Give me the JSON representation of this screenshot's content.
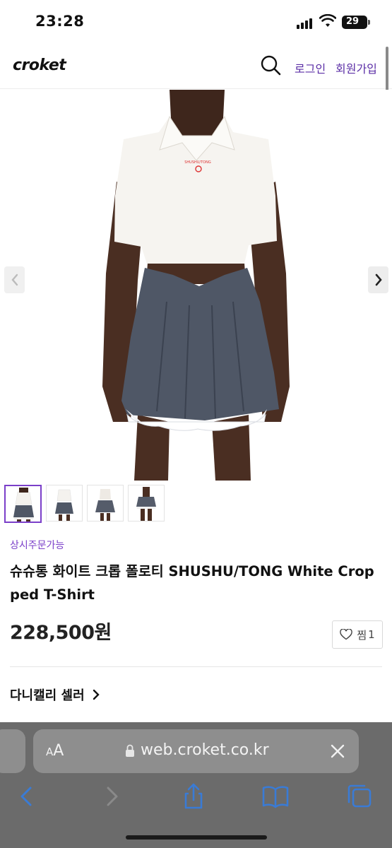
{
  "status_bar": {
    "time": "23:28",
    "battery": "29"
  },
  "header": {
    "logo": "croket",
    "login": "로그인",
    "signup": "회원가입"
  },
  "product": {
    "order_tag": "상시주문가능",
    "title": "슈슈통 화이트 크롭 폴로티 SHUSHU/TONG White Cropped T-Shirt",
    "price": "228,500원",
    "wish_label": "찜",
    "wish_count": "1",
    "seller": "다니캘리 셀러",
    "thumbnail_count": 4
  },
  "browser": {
    "aa": "AA",
    "url": "web.croket.co.kr"
  },
  "icons": {
    "search": "search-icon",
    "prev": "chevron-left-icon",
    "next": "chevron-right-icon",
    "heart": "heart-icon",
    "lock": "lock-icon",
    "close": "close-icon",
    "back": "back-icon",
    "forward": "forward-icon",
    "share": "share-icon",
    "bookmarks": "bookmarks-icon",
    "tabs": "tabs-icon"
  },
  "colors": {
    "accent": "#7b3fc9",
    "link": "#5b2ea6",
    "browser_bar": "#6b6b6b",
    "browser_blue": "#3a7bd5"
  }
}
